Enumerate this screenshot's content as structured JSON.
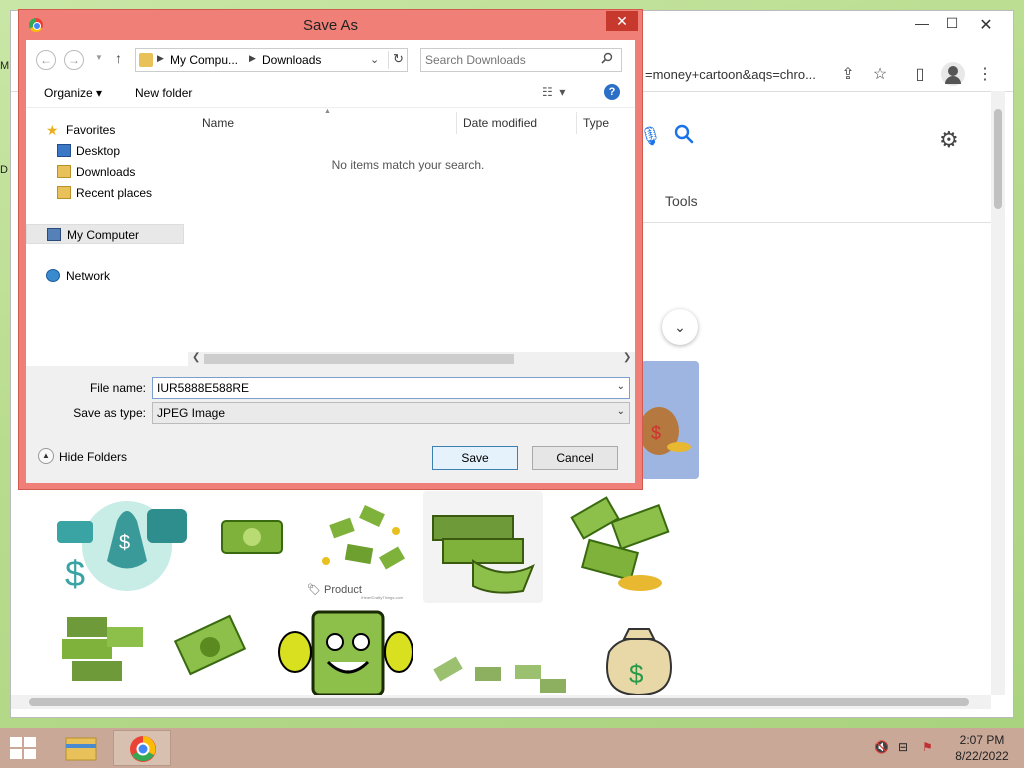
{
  "desktop": {
    "letters": [
      "M",
      "D"
    ]
  },
  "browser": {
    "address_text": "=money+cartoon&aqs=chro...",
    "tools_label": "Tools",
    "product_label": "Product",
    "watermark": "iHeartCraftyThings.com"
  },
  "dialog": {
    "title": "Save As",
    "breadcrumb": [
      "My Compu...",
      "Downloads"
    ],
    "search_placeholder": "Search Downloads",
    "toolbar": {
      "organize": "Organize",
      "new_folder": "New folder"
    },
    "nav_pane": {
      "favorites": "Favorites",
      "favorites_items": [
        "Desktop",
        "Downloads",
        "Recent places"
      ],
      "my_computer": "My Computer",
      "network": "Network"
    },
    "columns": [
      "Name",
      "Date modified",
      "Type"
    ],
    "empty_message": "No items match your search.",
    "file_name_label": "File name:",
    "file_name_value": "IUR5888E588RE",
    "save_type_label": "Save as type:",
    "save_type_value": "JPEG Image",
    "hide_folders": "Hide Folders",
    "save_button": "Save",
    "cancel_button": "Cancel"
  },
  "taskbar": {
    "time": "2:07 PM",
    "date": "8/22/2022"
  },
  "colors": {
    "dialog_frame": "#f08077",
    "close_button": "#c7392c",
    "taskbar": "#caa898",
    "money_green": "#7fb23a",
    "accent_blue": "#1a73e8"
  }
}
